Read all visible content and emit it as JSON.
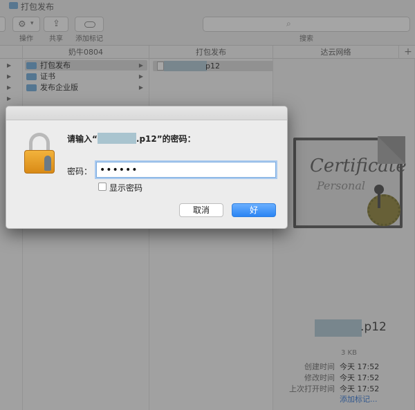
{
  "window": {
    "title": "打包发布"
  },
  "toolbar": {
    "action_label": "操作",
    "share_label": "共享",
    "tag_label": "添加标记",
    "search_placeholder": "搜索",
    "search_label": "搜索"
  },
  "columns": {
    "headers": [
      "奶牛0804",
      "打包发布",
      "达云网络"
    ],
    "add": "+"
  },
  "sidebar_column": {
    "items": [
      {
        "label": "打包发布",
        "selected": true
      },
      {
        "label": "证书",
        "selected": false
      },
      {
        "label": "发布企业版",
        "selected": false
      }
    ]
  },
  "file_column": {
    "file_ext": "p12"
  },
  "preview": {
    "cert_title": "Certificate",
    "cert_sub": "Personal",
    "name_ext": ".p12",
    "size": "3 KB",
    "meta": [
      {
        "key": "创建时间",
        "value": "今天 17:52"
      },
      {
        "key": "修改时间",
        "value": "今天 17:52"
      },
      {
        "key": "上次打开时间",
        "value": "今天 17:52"
      }
    ],
    "add_tag": "添加标记..."
  },
  "dialog": {
    "prompt_before": "请输入“",
    "prompt_after": ".p12”的密码：",
    "password_label": "密码：",
    "password_value": "••••••",
    "show_password_label": "显示密码",
    "cancel_label": "取消",
    "ok_label": "好"
  },
  "colors": {
    "accent": "#2a84f3",
    "folder": "#69a6d8",
    "lock": "#f2b33c"
  }
}
